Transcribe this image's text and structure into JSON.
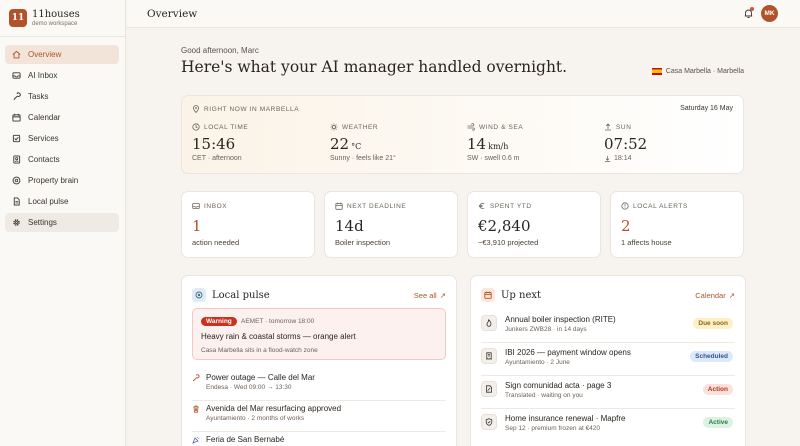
{
  "brand": {
    "logo_text": "11",
    "name": "11houses",
    "workspace": "demo workspace",
    "accent": "#b0532b"
  },
  "sidebar": {
    "items": [
      {
        "label": "Overview",
        "icon": "home-icon"
      },
      {
        "label": "AI Inbox",
        "icon": "inbox-icon"
      },
      {
        "label": "Tasks",
        "icon": "wrench-icon"
      },
      {
        "label": "Calendar",
        "icon": "calendar-icon"
      },
      {
        "label": "Services",
        "icon": "services-icon"
      },
      {
        "label": "Contacts",
        "icon": "contacts-icon"
      },
      {
        "label": "Property brain",
        "icon": "brain-icon"
      },
      {
        "label": "Local pulse",
        "icon": "document-icon"
      },
      {
        "label": "Settings",
        "icon": "gear-icon"
      }
    ]
  },
  "topbar": {
    "title": "Overview",
    "avatar": "MK"
  },
  "greeting": {
    "salutation": "Good afternoon, Marc",
    "headline": "Here's what your AI manager handled overnight.",
    "location": "Casa Marbella · Marbella"
  },
  "now": {
    "kicker": "RIGHT NOW IN MARBELLA",
    "date": "Saturday 16 May",
    "local_time": {
      "label": "LOCAL TIME",
      "value": "15:46",
      "sub": "CET · afternoon"
    },
    "weather": {
      "label": "WEATHER",
      "value": "22",
      "unit": "°C",
      "sub": "Sunny · feels like 21°"
    },
    "wind": {
      "label": "WIND & SEA",
      "value": "14",
      "unit": "km/h",
      "sub": "SW · swell 0.6 m"
    },
    "sun": {
      "label": "SUN",
      "value": "07:52",
      "sub": "18:14"
    }
  },
  "stats": [
    {
      "label": "INBOX",
      "value": "1",
      "desc": "action needed",
      "icon": "inbox-icon"
    },
    {
      "label": "NEXT DEADLINE",
      "value": "14d",
      "desc": "Boiler inspection",
      "icon": "calendar-icon"
    },
    {
      "label": "SPENT YTD",
      "value": "€2,840",
      "desc": "~€3,910 projected",
      "icon": "euro-icon"
    },
    {
      "label": "LOCAL ALERTS",
      "value": "2",
      "desc": "1 affects house",
      "icon": "alert-icon"
    }
  ],
  "local_pulse": {
    "title": "Local pulse",
    "link": "See all",
    "alert": {
      "pill": "Warning",
      "meta": "AEMET · tomorrow 18:00",
      "headline": "Heavy rain & coastal storms — orange alert",
      "detail": "Casa Marbella sits in a flood-watch zone"
    },
    "items": [
      {
        "title": "Power outage — Calle del Mar",
        "sub": "Endesa · Wed 09:00 → 13:30",
        "icon": "wrench-icon"
      },
      {
        "title": "Avenida del Mar resurfacing approved",
        "sub": "Ayuntamiento · 2 months of works",
        "icon": "trash-icon"
      },
      {
        "title": "Feria de San Bernabé",
        "sub": "",
        "icon": "party-icon"
      }
    ]
  },
  "up_next": {
    "title": "Up next",
    "link": "Calendar",
    "items": [
      {
        "title": "Annual boiler inspection (RITE)",
        "sub": "Junkers ZWB28 · in 14 days",
        "badge": "Due soon",
        "badge_bg": "#fdf0c8",
        "badge_fg": "#8a6a10",
        "icon": "flame-icon"
      },
      {
        "title": "IBI 2026 — payment window opens",
        "sub": "Ayuntamiento · 2 June",
        "badge": "Scheduled",
        "badge_bg": "#dde8f8",
        "badge_fg": "#2f5597",
        "icon": "receipt-icon"
      },
      {
        "title": "Sign comunidad acta · page 3",
        "sub": "Translated · waiting on you",
        "badge": "Action",
        "badge_bg": "#fbe1dc",
        "badge_fg": "#b0351f",
        "icon": "sign-icon"
      },
      {
        "title": "Home insurance renewal · Mapfre",
        "sub": "Sep 12 · premium frozen at €420",
        "badge": "Active",
        "badge_bg": "#dcf2e2",
        "badge_fg": "#2d7a45",
        "icon": "shield-icon"
      }
    ]
  }
}
